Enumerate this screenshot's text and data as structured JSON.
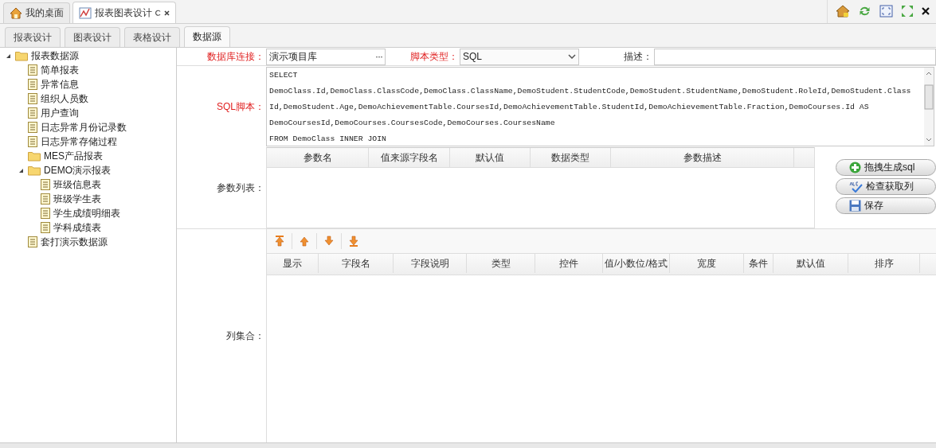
{
  "top_tabs": [
    {
      "label": "我的桌面",
      "selected": false,
      "closable": false
    },
    {
      "label": "报表图表设计",
      "selected": true,
      "closable": true
    }
  ],
  "sub_tabs": [
    {
      "label": "报表设计",
      "selected": false
    },
    {
      "label": "图表设计",
      "selected": false
    },
    {
      "label": "表格设计",
      "selected": false
    },
    {
      "label": "数据源",
      "selected": true
    }
  ],
  "tree": {
    "label": "报表数据源",
    "kind": "folder",
    "expanded": true,
    "children": [
      {
        "label": "简单报表",
        "kind": "report"
      },
      {
        "label": "异常信息",
        "kind": "report"
      },
      {
        "label": "组织人员数",
        "kind": "report"
      },
      {
        "label": "用户查询",
        "kind": "report"
      },
      {
        "label": "日志异常月份记录数",
        "kind": "report"
      },
      {
        "label": "日志异常存储过程",
        "kind": "report"
      },
      {
        "label": "MES产品报表",
        "kind": "folder"
      },
      {
        "label": "DEMO演示报表",
        "kind": "folder",
        "expanded": true,
        "children": [
          {
            "label": "班级信息表",
            "kind": "report"
          },
          {
            "label": "班级学生表",
            "kind": "report"
          },
          {
            "label": "学生成绩明细表",
            "kind": "report"
          },
          {
            "label": "学科成绩表",
            "kind": "report"
          }
        ]
      },
      {
        "label": "套打演示数据源",
        "kind": "report"
      }
    ]
  },
  "form": {
    "db_connection": {
      "label": "数据库连接：",
      "required": true,
      "value": "演示项目库",
      "button": "···"
    },
    "script_type": {
      "label": "脚本类型：",
      "required": true,
      "value": "SQL"
    },
    "description": {
      "label": "描述：",
      "required": false
    },
    "sql": {
      "label": "SQL脚本：",
      "required": true,
      "lines": [
        "SELECT",
        "DemoClass.Id,DemoClass.ClassCode,DemoClass.ClassName,DemoStudent.StudentCode,DemoStudent.StudentName,DemoStudent.RoleId,DemoStudent.Class",
        "Id,DemoStudent.Age,DemoAchievementTable.CoursesId,DemoAchievementTable.StudentId,DemoAchievementTable.Fraction,DemoCourses.Id AS",
        "DemoCoursesId,DemoCourses.CoursesCode,DemoCourses.CoursesName",
        "FROM DemoClass INNER JOIN"
      ]
    },
    "params": {
      "label": "参数列表：",
      "required": false,
      "columns": [
        "参数名",
        "值来源字段名",
        "默认值",
        "数据类型",
        "参数描述"
      ]
    },
    "actions": [
      {
        "label": "拖拽生成sql",
        "kind": "add"
      },
      {
        "label": "检查获取列",
        "kind": "check"
      },
      {
        "label": "保存",
        "kind": "save"
      }
    ],
    "columns_set": {
      "label": "列集合：",
      "required": false,
      "columns": [
        "显示",
        "字段名",
        "字段说明",
        "类型",
        "控件",
        "值/小数位/格式",
        "宽度",
        "条件",
        "默认值",
        "排序"
      ]
    }
  }
}
